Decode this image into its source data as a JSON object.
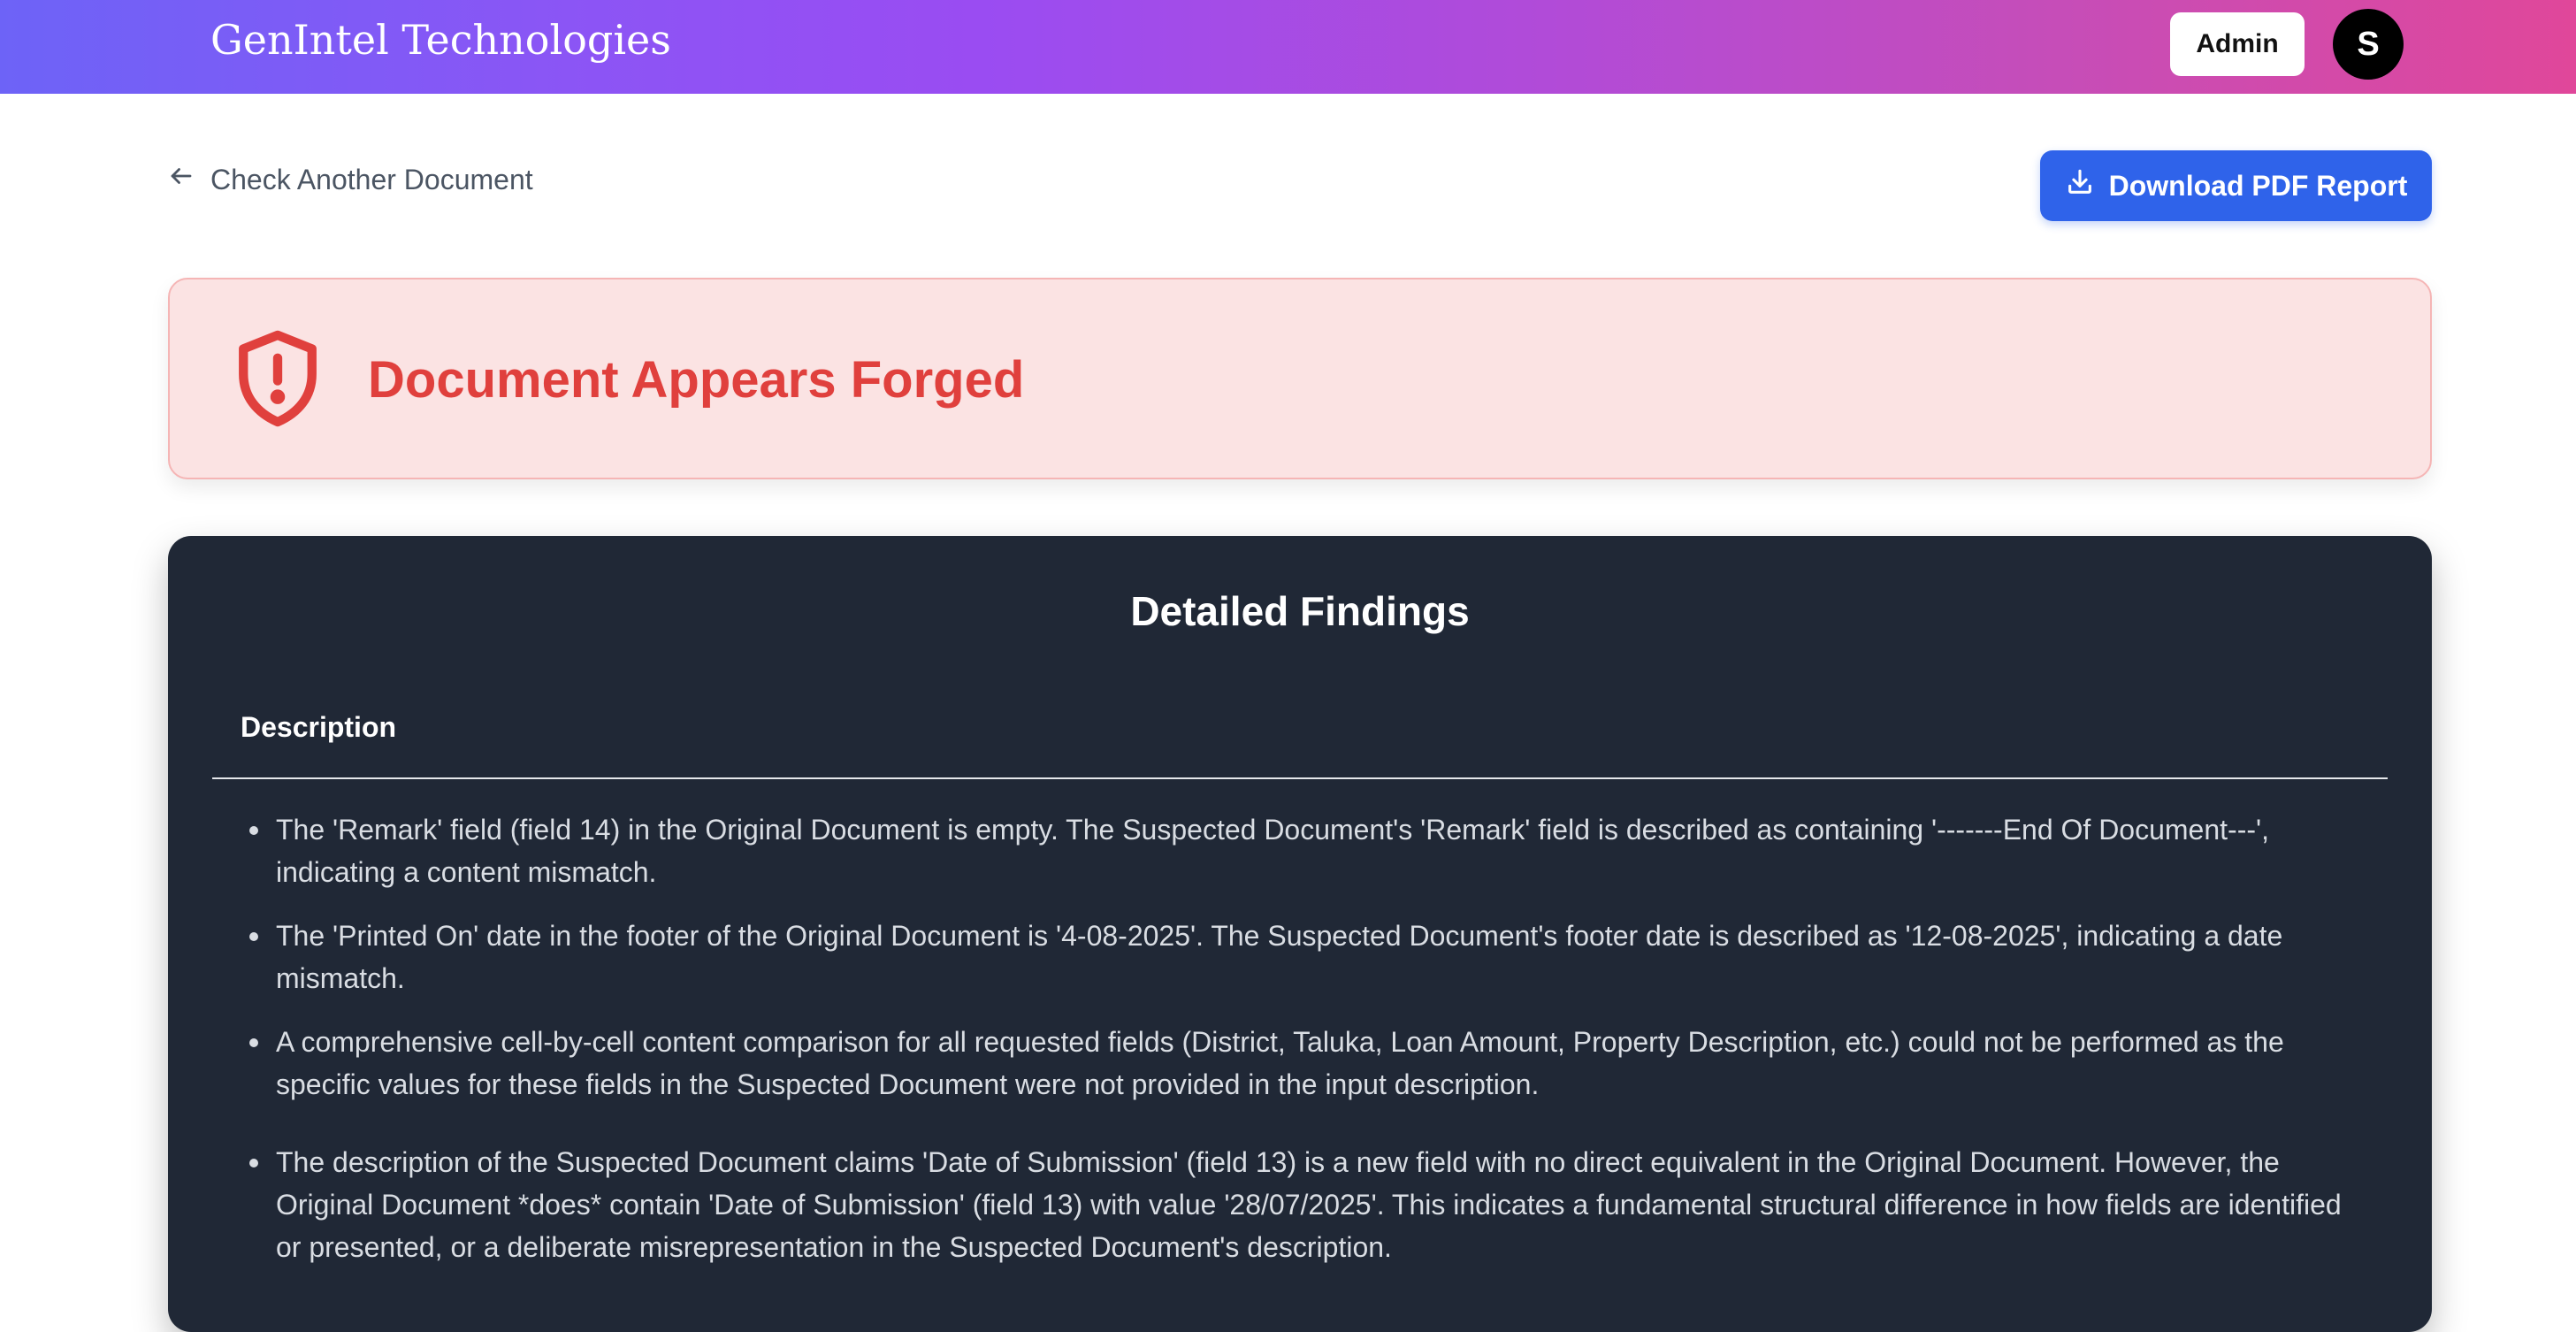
{
  "header": {
    "brand": "GenIntel Technologies",
    "admin_label": "Admin",
    "avatar_initial": "S"
  },
  "toolbar": {
    "back_label": "Check Another Document",
    "download_label": "Download PDF Report"
  },
  "alert": {
    "title": "Document Appears Forged",
    "icon": "shield-alert-icon",
    "color": "#e0403d",
    "background": "#fbe3e3"
  },
  "findings": {
    "title": "Detailed Findings",
    "column_header": "Description",
    "items": [
      "The 'Remark' field (field 14) in the Original Document is empty. The Suspected Document's 'Remark' field is described as containing '-------End Of Document---', indicating a content mismatch.",
      "The 'Printed On' date in the footer of the Original Document is '4-08-2025'. The Suspected Document's footer date is described as '12-08-2025', indicating a date mismatch.",
      "A comprehensive cell-by-cell content comparison for all requested fields (District, Taluka, Loan Amount, Property Description, etc.) could not be performed as the specific values for these fields in the Suspected Document were not provided in the input description.",
      "The description of the Suspected Document claims 'Date of Submission' (field 13) is a new field with no direct equivalent in the Original Document. However, the Original Document *does* contain 'Date of Submission' (field 13) with value '28/07/2025'. This indicates a fundamental structural difference in how fields are identified or presented, or a deliberate misrepresentation in the Suspected Document's description."
    ]
  },
  "colors": {
    "primary_button": "#2f63ea",
    "card_background": "#202836",
    "header_gradient_start": "#6d63f7",
    "header_gradient_end": "#e0479a"
  }
}
